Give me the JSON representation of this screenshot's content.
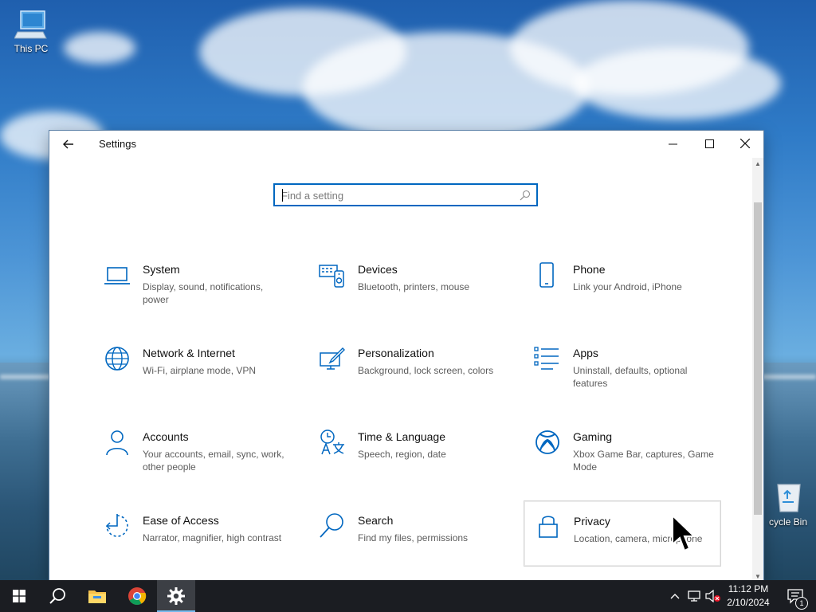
{
  "desktop": {
    "icons": [
      {
        "label": "This PC"
      },
      {
        "label": "cycle Bin"
      }
    ]
  },
  "window": {
    "title": "Settings",
    "search": {
      "placeholder": "Find a setting",
      "value": ""
    },
    "tiles": [
      {
        "name": "System",
        "desc": "Display, sound, notifications, power",
        "icon": "laptop-icon"
      },
      {
        "name": "Devices",
        "desc": "Bluetooth, printers, mouse",
        "icon": "devices-icon"
      },
      {
        "name": "Phone",
        "desc": "Link your Android, iPhone",
        "icon": "phone-icon"
      },
      {
        "name": "Network & Internet",
        "desc": "Wi-Fi, airplane mode, VPN",
        "icon": "globe-icon"
      },
      {
        "name": "Personalization",
        "desc": "Background, lock screen, colors",
        "icon": "paint-icon"
      },
      {
        "name": "Apps",
        "desc": "Uninstall, defaults, optional features",
        "icon": "apps-list-icon"
      },
      {
        "name": "Accounts",
        "desc": "Your accounts, email, sync, work, other people",
        "icon": "person-icon"
      },
      {
        "name": "Time & Language",
        "desc": "Speech, region, date",
        "icon": "time-language-icon"
      },
      {
        "name": "Gaming",
        "desc": "Xbox Game Bar, captures, Game Mode",
        "icon": "xbox-icon"
      },
      {
        "name": "Ease of Access",
        "desc": "Narrator, magnifier, high contrast",
        "icon": "ease-of-access-icon"
      },
      {
        "name": "Search",
        "desc": "Find my files, permissions",
        "icon": "search-icon"
      },
      {
        "name": "Privacy",
        "desc": "Location, camera, microphone",
        "icon": "lock-icon"
      }
    ]
  },
  "taskbar": {
    "clock_time": "11:12 PM",
    "clock_date": "2/10/2024",
    "notification_count": "1"
  },
  "colors": {
    "accent": "#0067c0",
    "icon_blue": "#0067c0",
    "taskbar": "#1b1d22"
  }
}
